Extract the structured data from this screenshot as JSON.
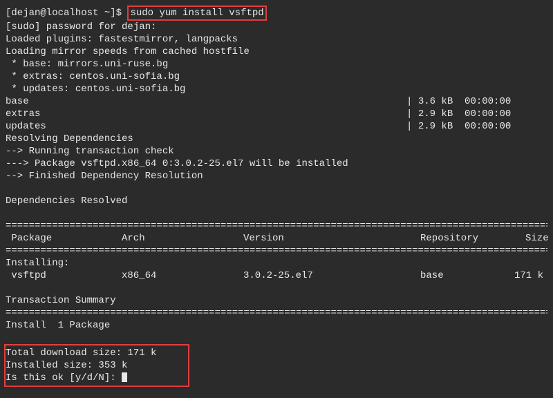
{
  "prompt": "[dejan@localhost ~]$ ",
  "command": "sudo yum install vsftpd",
  "sudo_pw": "[sudo] password for dejan:",
  "plugins": "Loaded plugins: fastestmirror, langpacks",
  "loading": "Loading mirror speeds from cached hostfile",
  "mirrors": [
    " * base: mirrors.uni-ruse.bg",
    " * extras: centos.uni-sofia.bg",
    " * updates: centos.uni-sofia.bg"
  ],
  "repos": [
    {
      "name": "base",
      "size": "3.6 kB",
      "time": "00:00:00"
    },
    {
      "name": "extras",
      "size": "2.9 kB",
      "time": "00:00:00"
    },
    {
      "name": "updates",
      "size": "2.9 kB",
      "time": "00:00:00"
    }
  ],
  "resolving": "Resolving Dependencies",
  "dep_lines": [
    "--> Running transaction check",
    "---> Package vsftpd.x86_64 0:3.0.2-25.el7 will be installed",
    "--> Finished Dependency Resolution"
  ],
  "deps_resolved": "Dependencies Resolved",
  "header": {
    "package": " Package",
    "arch": "Arch",
    "version": "Version",
    "repo": "Repository",
    "size": "Size"
  },
  "installing_label": "Installing:",
  "pkg_row": {
    "package": " vsftpd",
    "arch": "x86_64",
    "version": "3.0.2-25.el7",
    "repo": "base",
    "size": "171 k"
  },
  "txn_summary": "Transaction Summary",
  "install_count": "Install  1 Package",
  "dl_size": "Total download size: 171 k",
  "inst_size": "Installed size: 353 k",
  "confirm": "Is this ok [y/d/N]: "
}
